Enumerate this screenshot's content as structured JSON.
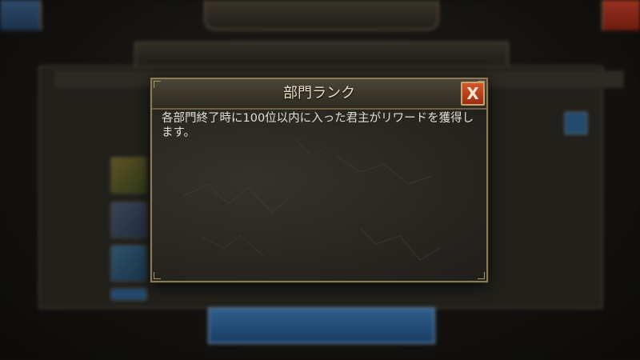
{
  "dialog": {
    "title": "部門ランク",
    "close_label": "X",
    "body": "各部門終了時に100位以内に入った君主がリワードを獲得します。"
  },
  "colors": {
    "close_button": "#c4421e",
    "dialog_border": "#8a7a55",
    "dialog_background": "#2a2822"
  }
}
